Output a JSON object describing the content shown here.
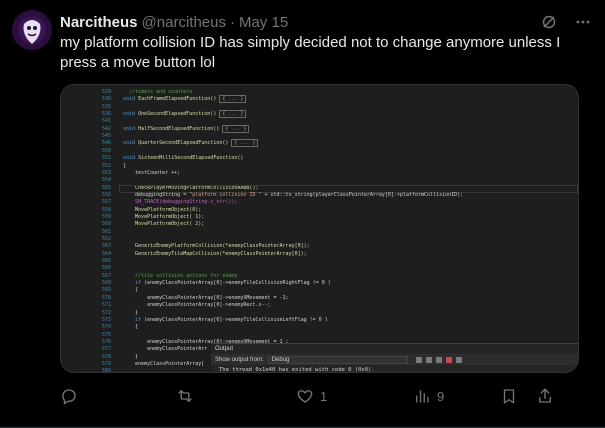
{
  "tweet": {
    "name": "Narcitheus",
    "handle": "@narcitheus",
    "separator": "·",
    "date": "May 15",
    "text": "my platform collision ID has simply decided not to change anymore unless I press a move button lol"
  },
  "actions": {
    "reply_count": "",
    "retweet_count": "",
    "like_count": "1",
    "views_count": "9"
  },
  "editor": {
    "lines": [
      {
        "n": "529",
        "code": "  //timers and counters",
        "type": "comment"
      },
      {
        "n": "530",
        "code": "void EachFrameElapsedFunction()",
        "type": "fn",
        "box": "{ ... }"
      },
      {
        "n": "535",
        "code": "",
        "type": "plain"
      },
      {
        "n": "536",
        "code": "void OneSecondElapsedFunction()",
        "type": "fn",
        "box": "{ ... }"
      },
      {
        "n": "541",
        "code": "",
        "type": "plain"
      },
      {
        "n": "542",
        "code": "void HalfSecondElapsedFunction()",
        "type": "fn",
        "box": "{ ... }"
      },
      {
        "n": "545",
        "code": "",
        "type": "plain"
      },
      {
        "n": "546",
        "code": "void QuarterSecondElapsedFunction()",
        "type": "fn",
        "box": "{ ... }"
      },
      {
        "n": "550",
        "code": "",
        "type": "plain"
      },
      {
        "n": "551",
        "code": "void SixteenMilliSecondElapsedFunction()",
        "type": "fn"
      },
      {
        "n": "552",
        "code": "{",
        "type": "plain"
      },
      {
        "n": "553",
        "code": "    testCounter ++;",
        "type": "plain"
      },
      {
        "n": "554",
        "code": "",
        "type": "plain"
      },
      {
        "n": "555",
        "code": "    CheckPlayerMovingPlatformCollisionAABB();",
        "type": "call"
      },
      {
        "n": "556",
        "code": "    debuggingString = \"platform collision ID \" + std::to_string(playerClassPointerArray[0]->platformCollisionID);",
        "type": "str"
      },
      {
        "n": "557",
        "code": "    SM_TRACE(debuggingString.c_str());",
        "type": "macro"
      },
      {
        "n": "558",
        "code": "    MovePlatformObject(0);",
        "type": "call"
      },
      {
        "n": "559",
        "code": "    MovePlatformObject( 1);",
        "type": "call"
      },
      {
        "n": "560",
        "code": "    MovePlatformObject( 2);",
        "type": "call"
      },
      {
        "n": "561",
        "code": "",
        "type": "plain"
      },
      {
        "n": "562",
        "code": "",
        "type": "plain"
      },
      {
        "n": "563",
        "code": "    GenericEnemyPlatformCollision(*enemyClassPointerArray[0]);",
        "type": "call"
      },
      {
        "n": "564",
        "code": "    GenericEnemyTileMapCollision(*enemyClassPointerArray[0]);",
        "type": "call"
      },
      {
        "n": "565",
        "code": "",
        "type": "plain"
      },
      {
        "n": "566",
        "code": "",
        "type": "plain"
      },
      {
        "n": "567",
        "code": "    //tile collision actions for enemy",
        "type": "comment"
      },
      {
        "n": "568",
        "code": "    if (enemyClassPointerArray[0]->enemyTileCollisionRightFlag != 0 )",
        "type": "if"
      },
      {
        "n": "569",
        "code": "    {",
        "type": "plain"
      },
      {
        "n": "570",
        "code": "        enemyClassPointerArray[0]->enemyXMovement = -1;",
        "type": "plain"
      },
      {
        "n": "571",
        "code": "        enemyClassPointerArray[0]->enemyRect.x--;",
        "type": "plain"
      },
      {
        "n": "572",
        "code": "    }",
        "type": "plain"
      },
      {
        "n": "573",
        "code": "    if (enemyClassPointerArray[0]->enemyTileCollisionLeftFlag != 0 )",
        "type": "if"
      },
      {
        "n": "574",
        "code": "    {",
        "type": "plain"
      },
      {
        "n": "575",
        "code": "",
        "type": "plain"
      },
      {
        "n": "576",
        "code": "        enemyClassPointerArray[0]->enemyXMovement = 1 ;",
        "type": "plain"
      },
      {
        "n": "577",
        "code": "        enemyClassPointerArr",
        "type": "plain"
      },
      {
        "n": "578",
        "code": "    }",
        "type": "plain"
      },
      {
        "n": "579",
        "code": "    enemyClassPointerArray[",
        "type": "plain"
      },
      {
        "n": "580",
        "code": "",
        "type": "plain"
      }
    ],
    "output": {
      "title": "Output",
      "show_label": "Show output from:",
      "source": "Debug",
      "text": "The thread 0x1e40 has exited with code 0 (0x0)."
    }
  }
}
